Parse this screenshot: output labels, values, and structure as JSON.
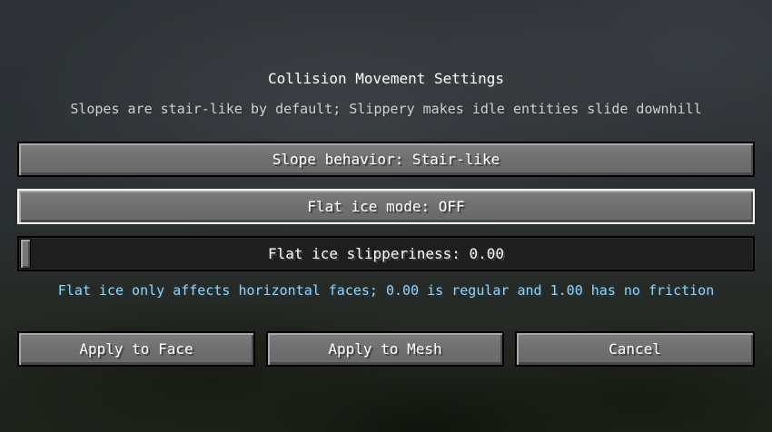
{
  "screen": {
    "title": "Collision Movement Settings",
    "subtitle": "Slopes are stair-like by default; Slippery makes idle entities slide downhill"
  },
  "options": {
    "slope_behavior_label": "Slope behavior: Stair-like",
    "flat_ice_mode_label": "Flat ice mode: OFF",
    "flat_ice_slipperiness": {
      "label": "Flat ice slipperiness: 0.00",
      "value": 0.0,
      "min": 0.0,
      "max": 1.0
    },
    "hint": "Flat ice only affects horizontal faces; 0.00 is regular and 1.00 has no friction"
  },
  "footer": {
    "apply_face_label": "Apply to Face",
    "apply_mesh_label": "Apply to Mesh",
    "cancel_label": "Cancel"
  },
  "colors": {
    "text": "#ffffff",
    "subtitle": "#cfcfcf",
    "hint": "#8fd6ff",
    "button_face": "#6f6f6f",
    "slider_track": "#1e1e1e",
    "hover_border": "#ffffff"
  }
}
